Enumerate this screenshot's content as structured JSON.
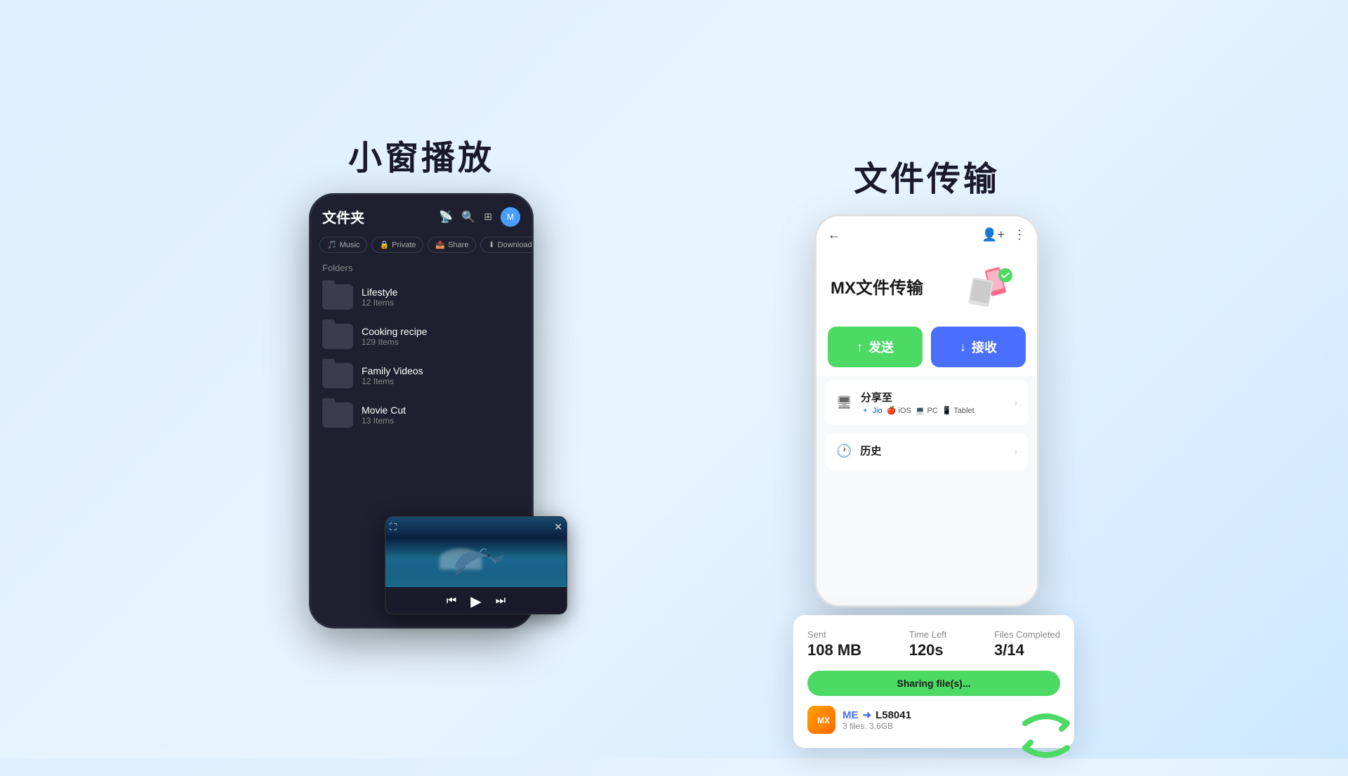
{
  "left": {
    "title": "小窗播放",
    "phone": {
      "header_title": "文件夹",
      "tabs": [
        {
          "label": "Music",
          "icon": "🎵"
        },
        {
          "label": "Private",
          "icon": "🔒"
        },
        {
          "label": "Share",
          "icon": "📤"
        },
        {
          "label": "Download",
          "icon": "⬇"
        }
      ],
      "folders_label": "Folders",
      "folders": [
        {
          "name": "Lifestyle",
          "count": "12 Items"
        },
        {
          "name": "Cooking recipe",
          "count": "129 Items"
        },
        {
          "name": "Family Videos",
          "count": "12 Items"
        },
        {
          "name": "Movie Cut",
          "count": "13 Items"
        }
      ]
    },
    "player": {
      "close_btn": "✕",
      "expand_btn": "⛶",
      "prev_btn": "⏮",
      "play_btn": "▶",
      "next_btn": "⏭"
    }
  },
  "right": {
    "title": "文件传输",
    "phone": {
      "mx_title": "MX文件传输",
      "send_btn": "↑ 发送",
      "receive_btn": "↓ 接收",
      "share_title": "分享至",
      "share_platforms": [
        "Jio",
        "iOS",
        "PC",
        "Tablet"
      ],
      "history_title": "历史"
    },
    "card": {
      "sent_label": "Sent",
      "sent_value": "108 MB",
      "time_label": "Time Left",
      "time_value": "120s",
      "files_label": "Files Completed",
      "files_value": "3/14",
      "progress_text": "Sharing file(s)...",
      "peer_from": "ME",
      "peer_to": "L58041",
      "peer_files": "3 files. 3.6GB"
    }
  }
}
